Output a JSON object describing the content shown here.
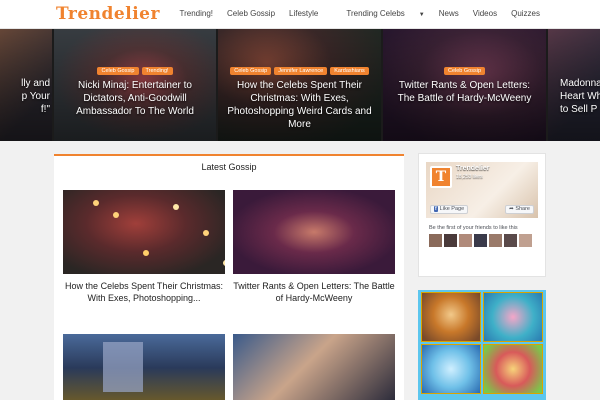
{
  "header": {
    "logo": "Trendelier",
    "nav": [
      {
        "label": "Trending!",
        "dropdown": false
      },
      {
        "label": "Celeb Gossip",
        "dropdown": false
      },
      {
        "label": "Lifestyle",
        "dropdown": false
      },
      {
        "label": "Trending Celebs",
        "dropdown": true
      },
      {
        "label": "News",
        "dropdown": false
      },
      {
        "label": "Videos",
        "dropdown": false
      },
      {
        "label": "Quizzes",
        "dropdown": false
      }
    ]
  },
  "slider": {
    "slides": [
      {
        "tags": [],
        "title": "lly and\np Your\nf!\""
      },
      {
        "tags": [
          "Celeb Gossip",
          "Trending!"
        ],
        "title": "Nicki Minaj: Entertainer to Dictators, Anti-Goodwill Ambassador To The World"
      },
      {
        "tags": [
          "Celeb Gossip",
          "Jennifer Lawrence",
          "Kardashians"
        ],
        "title": "How the Celebs Spent Their Christmas: With Exes, Photoshopping Weird Cards and More"
      },
      {
        "tags": [
          "Celeb Gossip"
        ],
        "title": "Twitter Rants & Open Letters: The Battle of Hardy-McWeeny"
      },
      {
        "tags": [],
        "title": "Madonna\nHeart Wh\nto Sell P"
      }
    ]
  },
  "main": {
    "section_title": "Latest Gossip",
    "cards": [
      {
        "title": "How the Celebs Spent Their Christmas: With Exes, Photoshopping..."
      },
      {
        "title": "Twitter Rants & Open Letters: The Battle of Hardy-McWeeny"
      },
      {
        "title": ""
      },
      {
        "title": ""
      }
    ]
  },
  "sidebar": {
    "fb_widget": {
      "page_name": "Trendelier",
      "likes": "18,253 likes",
      "like_button": "Like Page",
      "share_button": "Share",
      "friends_text": "Be the first of your friends to like this"
    }
  },
  "colors": {
    "accent": "#f0832f",
    "slider_background": "#1b1b1b",
    "page_background": "#f1f1f1",
    "facebook_blue": "#4267b2"
  }
}
